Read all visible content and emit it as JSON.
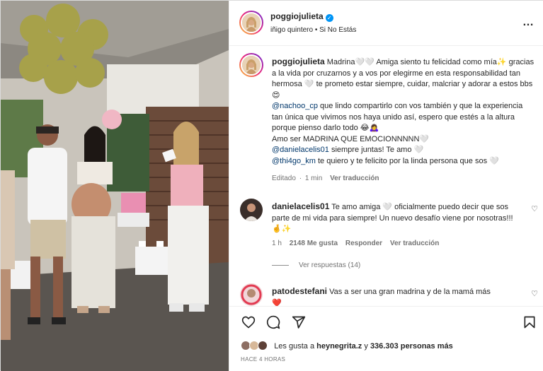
{
  "post": {
    "author": "poggiojulieta",
    "verified_mark": "✓",
    "audio_artist": "iñigo quintero",
    "audio_separator": "•",
    "audio_title": "Si No Estás",
    "more_icon": "…"
  },
  "caption": {
    "author": "poggiojulieta",
    "line1": "Madrina🤍🤍 Amiga siento tu felicidad como mía✨ gracias a la vida por cruzarnos y a vos por elegirme en esta responsabilidad tan hermosa 🤍 te prometo estar siempre, cuidar, malcriar y adorar a estos bbs 😍",
    "mention1": "@nachoo_cp",
    "line2": " que lindo compartirlo con vos también y que la experiencia tan única que vivimos nos haya unido así, espero que estés a la altura porque pienso darlo todo 😂🙇‍♀️",
    "line3": "Amo ser MADRINA QUE EMOCIONNNNN🤍",
    "mention2": "@danielacelis01",
    "line4": " siempre juntas! Te amo 🤍",
    "mention3": "@thi4go_km",
    "line5": " te quiero y te felicito por la linda persona que sos 🤍",
    "meta_edited": "Editado",
    "meta_dot": "·",
    "meta_time": "1 min",
    "meta_translate": "Ver traducción"
  },
  "comments": [
    {
      "author": "danielacelis01",
      "text": "Te amo amiga 🤍 oficialmente puedo decir que sos parte de mi vida para siempre! Un nuevo desafío viene por nosotras!!! 🤞✨",
      "time": "1 h",
      "likes": "2148 Me gusta",
      "reply": "Responder",
      "translate": "Ver traducción",
      "view_replies": "Ver respuestas (14)"
    },
    {
      "author": "patodestefani",
      "text": "Vas a ser una gran madrina y de la mamá más",
      "trailing": "❤️"
    }
  ],
  "footer": {
    "likes_prefix": "Les gusta a",
    "likes_user": "heynegrita.z",
    "likes_middle": "y",
    "likes_count": "336.303 personas más",
    "time_ago": "HACE 4 HORAS"
  },
  "icons": {
    "heart": "heart-icon",
    "comment": "comment-icon",
    "share": "share-icon",
    "save": "bookmark-icon",
    "comment_like": "♡"
  },
  "colors": {
    "mention": "#00376b",
    "verified": "#0095f6",
    "muted": "#737373"
  }
}
